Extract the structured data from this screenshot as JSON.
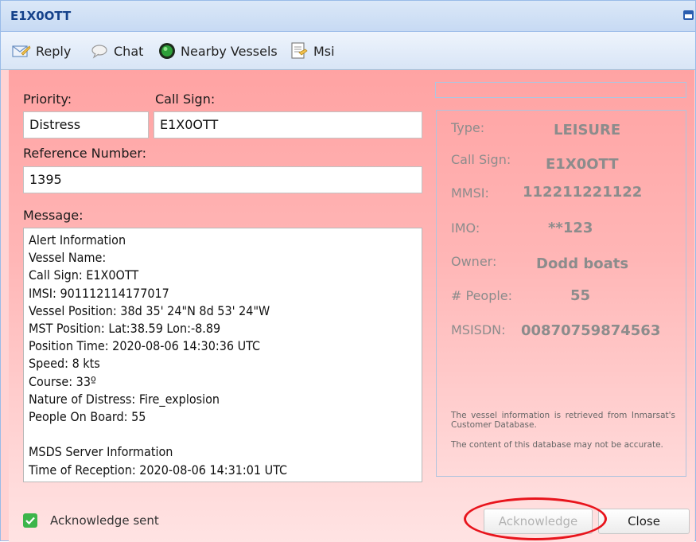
{
  "window": {
    "title": "E1X0OTT"
  },
  "toolbar": {
    "reply_label": "Reply",
    "chat_label": "Chat",
    "nearby_label": "Nearby Vessels",
    "msi_label": "Msi"
  },
  "form": {
    "priority_label": "Priority:",
    "priority_value": "Distress",
    "callsign_label": "Call Sign:",
    "callsign_value": "E1X0OTT",
    "refnum_label": "Reference Number:",
    "refnum_value": "1395",
    "message_label": "Message:",
    "message_value": "Alert Information\nVessel Name:\nCall Sign: E1X0OTT\nIMSI: 901112114177017\nVessel Position: 38d 35' 24\"N 8d 53' 24\"W\nMST Position: Lat:38.59 Lon:-8.89\nPosition Time: 2020-08-06 14:30:36 UTC\nSpeed: 8 kts\nCourse: 33º\nNature of Distress: Fire_explosion\nPeople On Board: 55\n\nMSDS Server Information\nTime of Reception: 2020-08-06 14:31:01 UTC"
  },
  "vessel": {
    "type_label": "Type:",
    "type_value": "LEISURE",
    "callsign_label": "Call Sign:",
    "callsign_value": "E1X0OTT",
    "mmsi_label": "MMSI:",
    "mmsi_value": "112211221122",
    "imo_label": "IMO:",
    "imo_value": "**123",
    "owner_label": "Owner:",
    "owner_value": "Dodd boats",
    "people_label": "# People:",
    "people_value": "55",
    "msisdn_label": "MSISDN:",
    "msisdn_value": "00870759874563",
    "note1": "The vessel information is retrieved from Inmarsat's Customer Database.",
    "note2": "The content of this database may not be accurate."
  },
  "footer": {
    "ack_status": "Acknowledge sent",
    "ack_button": "Acknowledge",
    "close_button": "Close"
  },
  "colors": {
    "accent_blue": "#15428b",
    "panel_pink": "#ffa3a3",
    "highlight_red": "#e8141c",
    "check_green": "#3cb54a"
  }
}
